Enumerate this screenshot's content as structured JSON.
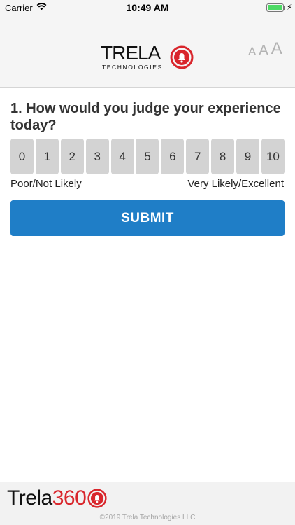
{
  "status_bar": {
    "carrier": "Carrier",
    "time": "10:49 AM",
    "battery_level": 1.0,
    "battery_color": "#4cd964"
  },
  "header": {
    "logo_name": "TRELA",
    "logo_subtitle": "TECHNOLOGIES",
    "font_size_controls": [
      "A",
      "A",
      "A"
    ]
  },
  "survey": {
    "question": "1. How would you judge your experience today?",
    "scale": [
      "0",
      "1",
      "2",
      "3",
      "4",
      "5",
      "6",
      "7",
      "8",
      "9",
      "10"
    ],
    "low_label": "Poor/Not Likely",
    "high_label": "Very Likely/Excellent",
    "submit_label": "SUBMIT"
  },
  "footer": {
    "brand_text": "Trela",
    "brand_number": "360",
    "copyright": "©2019 Trela Technologies LLC"
  },
  "colors": {
    "accent": "#1f7ec7",
    "brand_red": "#d9262c",
    "scale_button": "#d3d3d3"
  }
}
